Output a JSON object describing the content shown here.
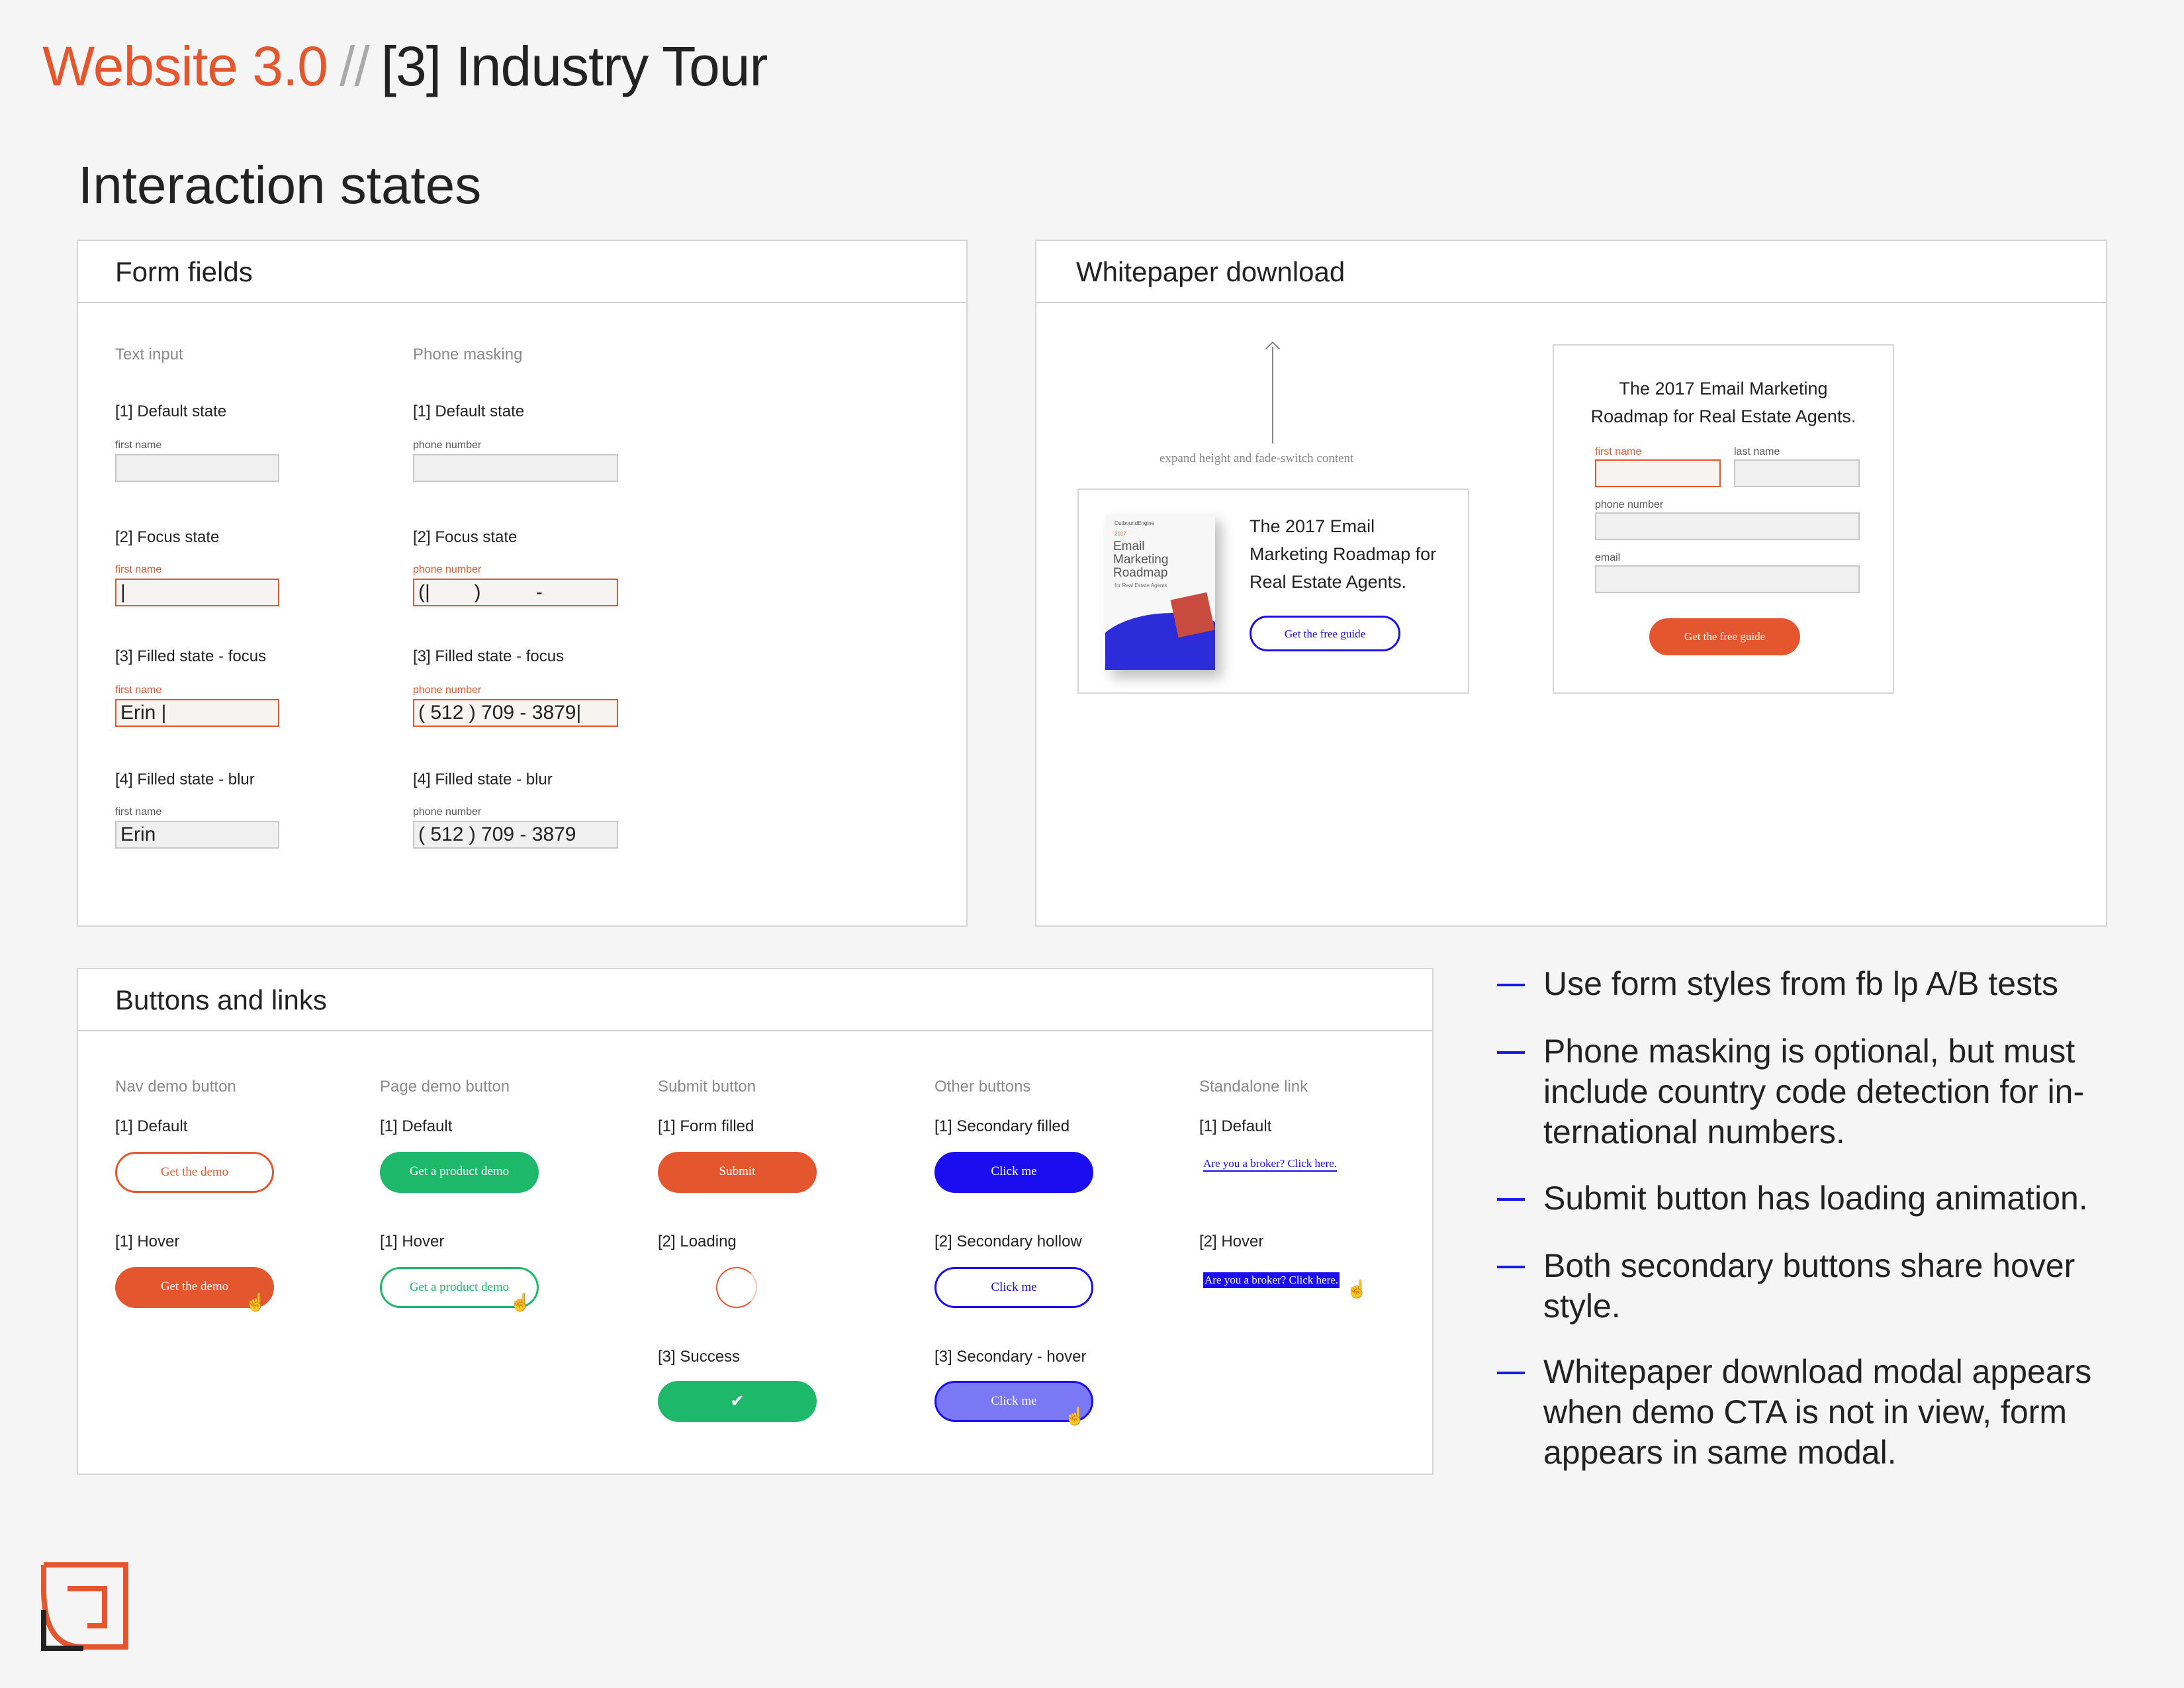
{
  "header": {
    "title_brand": "Website 3.0",
    "title_sep": "//",
    "title_page": "[3] Industry Tour",
    "subtitle": "Interaction states"
  },
  "form_fields": {
    "title": "Form fields",
    "col_text": "Text input",
    "col_phone": "Phone masking",
    "states": [
      "[1] Default state",
      "[2] Focus state",
      "[3] Filled state - focus",
      "[4] Filled state - blur"
    ],
    "first_name_label": "first name",
    "phone_label": "phone number",
    "text_values": [
      "",
      "|",
      "Erin |",
      "Erin"
    ],
    "phone_values": [
      "",
      "(|        )          -",
      "( 512 ) 709 - 3879|",
      "( 512 ) 709 - 3879"
    ]
  },
  "whitepaper": {
    "title": "Whitepaper download",
    "annotation": "expand height and fade-switch content",
    "card_text": "The 2017 Email Marketing Roadmap for Real Estate Agents.",
    "card_line1": "The 2017 Email",
    "card_line2": "Marketing Roadmap for",
    "card_line3": "Real Estate Agents.",
    "card_button": "Get the free guide",
    "book_brand": "OutboundEngine",
    "book_year": "2017",
    "book_title1": "Email",
    "book_title2": "Marketing",
    "book_title3": "Roadmap",
    "book_sub": "for Real Estate Agents",
    "modal_line1": "The 2017 Email Marketing",
    "modal_line2": "Roadmap for Real Estate Agents.",
    "modal_first": "first name",
    "modal_last": "last name",
    "modal_phone": "phone number",
    "modal_email": "email",
    "modal_button": "Get the free guide"
  },
  "buttons": {
    "title": "Buttons and links",
    "columns": [
      "Nav demo button",
      "Page demo button",
      "Submit button",
      "Other buttons",
      "Standalone link"
    ],
    "nav": {
      "s1": "[1] Default",
      "s2": "[1] Hover",
      "label": "Get the demo"
    },
    "page": {
      "s1": "[1] Default",
      "s2": "[1] Hover",
      "label": "Get a product demo"
    },
    "submit": {
      "s1": "[1] Form filled",
      "s2": "[2] Loading",
      "s3": "[3] Success",
      "label": "Submit"
    },
    "other": {
      "s1": "[1] Secondary filled",
      "s2": "[2] Secondary hollow",
      "s3": "[3] Secondary - hover",
      "label": "Click me"
    },
    "link": {
      "s1": "[1] Default",
      "s2": "[2] Hover",
      "label": "Are you a broker? Click here."
    }
  },
  "notes": [
    [
      "Use form styles from fb lp A/B tests"
    ],
    [
      "Phone masking is optional, but must",
      "include country code detection for in-",
      "ternational numbers."
    ],
    [
      "Submit button has loading animation."
    ],
    [
      "Both secondary buttons share hover",
      "style."
    ],
    [
      "Whitepaper download modal appears",
      "when demo CTA is not in view, form",
      "appears in same modal."
    ]
  ],
  "colors": {
    "orange": "#e4572e",
    "green": "#1db86a",
    "blue": "#1a0ef0",
    "violet": "#7b78f5"
  }
}
